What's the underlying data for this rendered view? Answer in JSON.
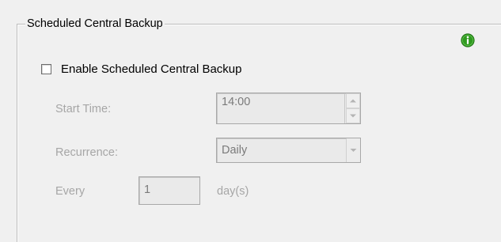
{
  "group": {
    "title": "Scheduled Central Backup"
  },
  "enable": {
    "label": "Enable Scheduled Central Backup",
    "checked": false
  },
  "start_time": {
    "label": "Start Time:",
    "value": "14:00"
  },
  "recurrence": {
    "label": "Recurrence:",
    "value": "Daily"
  },
  "every": {
    "label": "Every",
    "value": "1",
    "unit": "day(s)"
  },
  "icons": {
    "info": "info-icon",
    "spin_up": "chevron-up-icon",
    "spin_down": "chevron-down-icon",
    "dropdown": "chevron-down-icon"
  },
  "colors": {
    "background": "#f0f0f0",
    "info_icon": "#2f9a1f",
    "disabled_text": "#a6a6a6"
  }
}
